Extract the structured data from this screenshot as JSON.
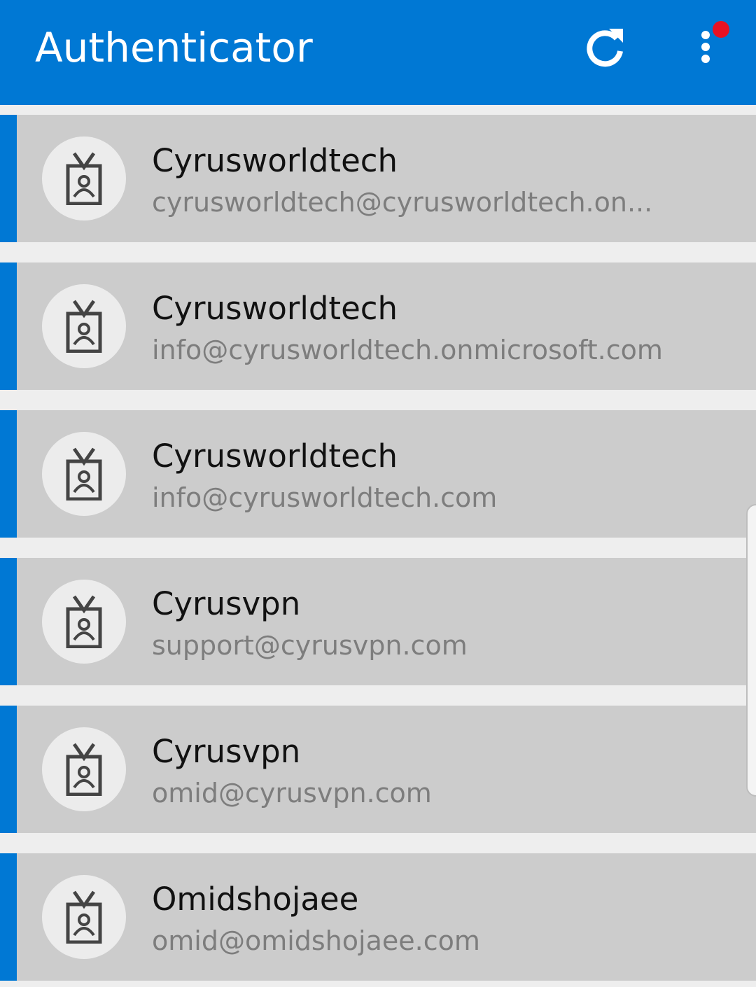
{
  "app_bar": {
    "title": "Authenticator",
    "color": "#0078d4",
    "refresh_icon": "refresh-icon",
    "more_icon": "more-vertical-icon",
    "notification_dot_color": "#e81123"
  },
  "accounts": [
    {
      "name": "Cyrusworldtech",
      "email": "cyrusworldtech@cyrusworldtech.on...",
      "icon": "id-badge-icon"
    },
    {
      "name": "Cyrusworldtech",
      "email": "info@cyrusworldtech.onmicrosoft.com",
      "icon": "id-badge-icon"
    },
    {
      "name": "Cyrusworldtech",
      "email": "info@cyrusworldtech.com",
      "icon": "id-badge-icon"
    },
    {
      "name": "Cyrusvpn",
      "email": "support@cyrusvpn.com",
      "icon": "id-badge-icon"
    },
    {
      "name": "Cyrusvpn",
      "email": "omid@cyrusvpn.com",
      "icon": "id-badge-icon"
    },
    {
      "name": "Omidshojaee",
      "email": "omid@omidshojaee.com",
      "icon": "id-badge-icon"
    }
  ]
}
